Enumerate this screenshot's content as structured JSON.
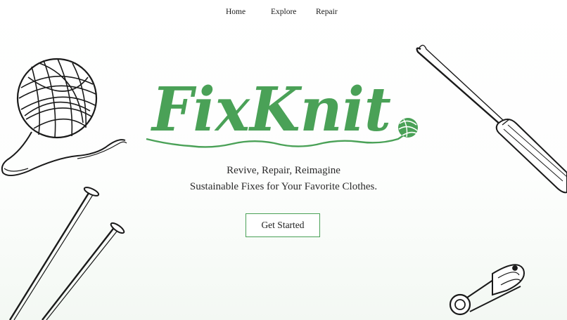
{
  "nav": {
    "home": "Home",
    "explore": "Explore",
    "repair": "Repair"
  },
  "hero": {
    "logo": "FixKnit",
    "tagline_line1": "Revive, Repair, Reimagine",
    "tagline_line2": "Sustainable Fixes for Your Favorite Clothes.",
    "cta_label": "Get Started"
  },
  "colors": {
    "accent": "#4aa157",
    "ink": "#1a1a1a"
  },
  "icons": [
    "yarn-ball-icon",
    "knitting-needles-icon",
    "crochet-hook-icon",
    "safety-pin-icon"
  ]
}
